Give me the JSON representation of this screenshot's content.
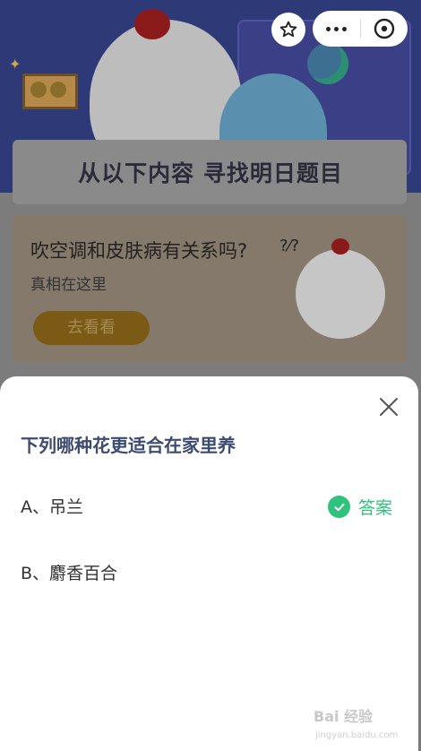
{
  "background": {
    "headline": "从以下内容  寻找明日题目",
    "question": "吹空调和皮肤病有关系吗?",
    "subtitle": "真相在这里",
    "button_label": "去看看",
    "question_marks": "?⁄?"
  },
  "capsule": {
    "favorite_icon": "star-outline-icon",
    "more_icon": "more-dots-icon",
    "close_icon": "circle-close-icon"
  },
  "sheet": {
    "title": "下列哪种花更适合在家里养",
    "options": [
      {
        "label": "A、吊兰",
        "correct": true
      },
      {
        "label": "B、麝香百合",
        "correct": false
      }
    ],
    "answer_label": "答案",
    "answer_color": "#2fc27b",
    "close_icon": "close-x-icon"
  },
  "watermark": {
    "text": "Bai 经验",
    "url_text": "jingyan.baidu.com"
  }
}
